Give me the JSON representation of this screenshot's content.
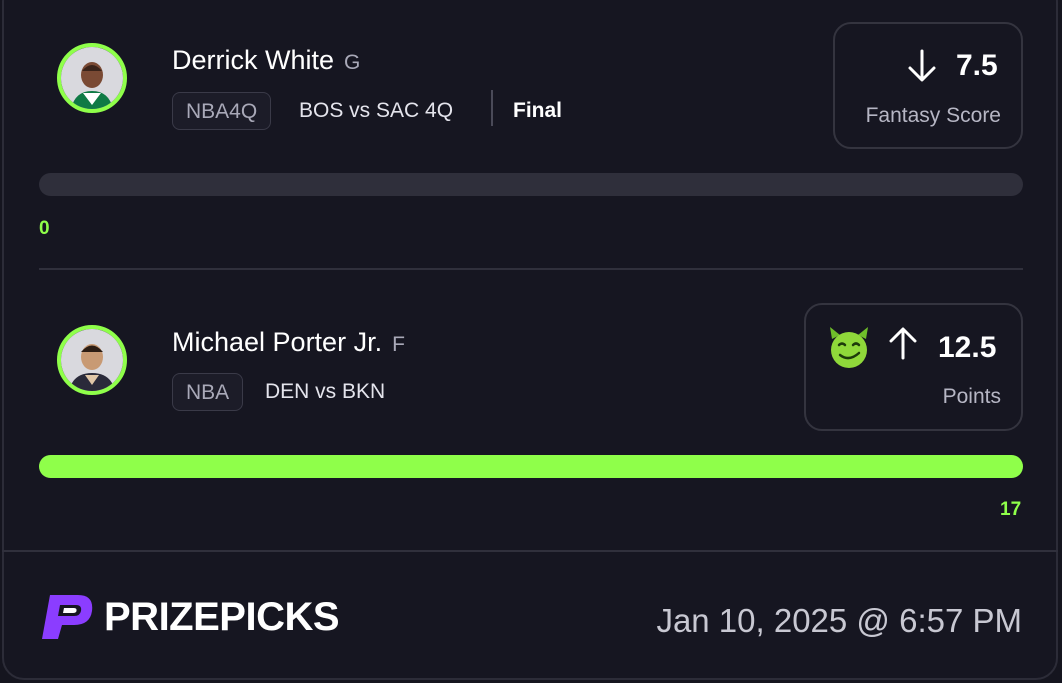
{
  "picks": [
    {
      "player_name": "Derrick White",
      "position": "G",
      "league": "NBA4Q",
      "matchup": "BOS vs SAC 4Q",
      "status": "Final",
      "direction": "down",
      "line": "7.5",
      "stat": "Fantasy Score",
      "progress_value": "0",
      "progress_fraction": 0
    },
    {
      "player_name": "Michael Porter Jr.",
      "position": "F",
      "league": "NBA",
      "matchup": "DEN vs BKN",
      "direction": "up",
      "badge_icon": "green-devil-emoji-icon",
      "line": "12.5",
      "stat": "Points",
      "progress_value": "17",
      "progress_fraction": 1
    }
  ],
  "footer": {
    "brand": "PRIZEPICKS",
    "timestamp": "Jan 10, 2025 @ 6:57 PM"
  },
  "colors": {
    "accent": "#8fff4a",
    "background": "#161621",
    "brand_purple": "#8b3dff"
  }
}
